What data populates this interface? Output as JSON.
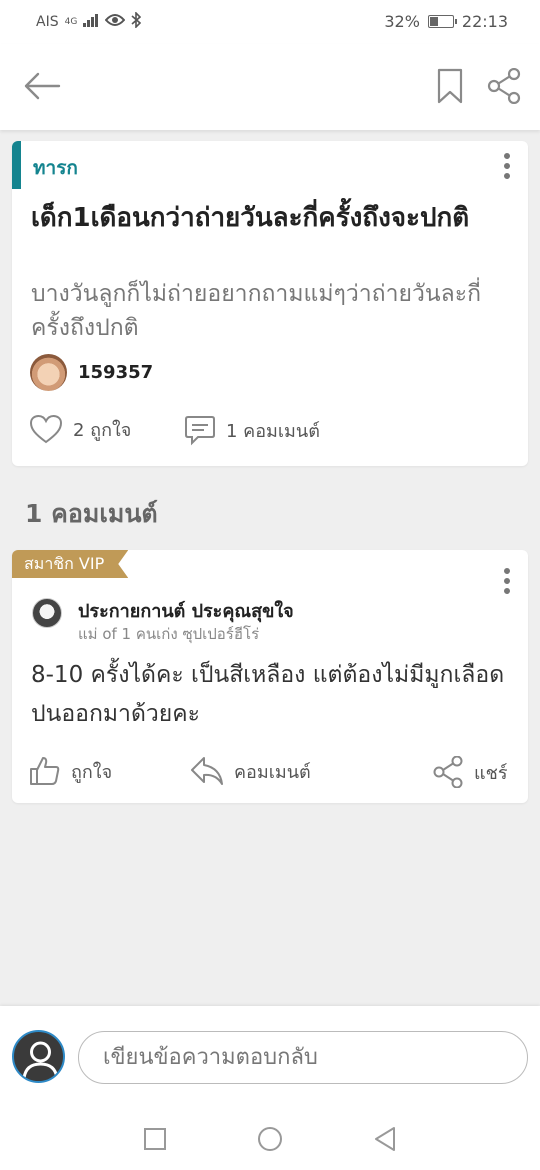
{
  "status_bar": {
    "carrier": "AIS",
    "network": "4G",
    "battery_percent_text": "32%",
    "battery_level": 0.32,
    "time": "22:13"
  },
  "header": {
    "icons": [
      "back-arrow-icon",
      "bookmark-icon",
      "share-icon"
    ]
  },
  "post": {
    "category": "ทารก",
    "title": "เด็ก1เดือนกว่าถ่ายวันละกี่ครั้งถึงจะปกติ",
    "body": "บางวันลูกก็ไม่ถ่ายอยากถามแม่ๆว่าถ่ายวันละกี่ครั้งถึงปกติ",
    "author": "159357",
    "likes_label": "2 ถูกใจ",
    "comments_label": "1 คอมเมนต์"
  },
  "comments_heading": "1 คอมเมนต์",
  "comment": {
    "badge": "สมาชิก VIP",
    "author": "ประกายกานต์ ประคุณสุขใจ",
    "subtitle": "แม่ of 1 คนเก่ง ซุปเปอร์ฮีโร่",
    "text": "8-10 ครั้งได้คะ เป็นสีเหลือง แต่ต้องไม่มีมูกเลือดปนออกมาด้วยคะ",
    "like_label": "ถูกใจ",
    "reply_label": "คอมเมนต์",
    "share_label": "แชร์"
  },
  "reply_box": {
    "placeholder": "เขียนข้อความตอบกลับ"
  },
  "colors": {
    "accent": "#14848f",
    "vip": "#c09a57",
    "background": "#efefef"
  }
}
